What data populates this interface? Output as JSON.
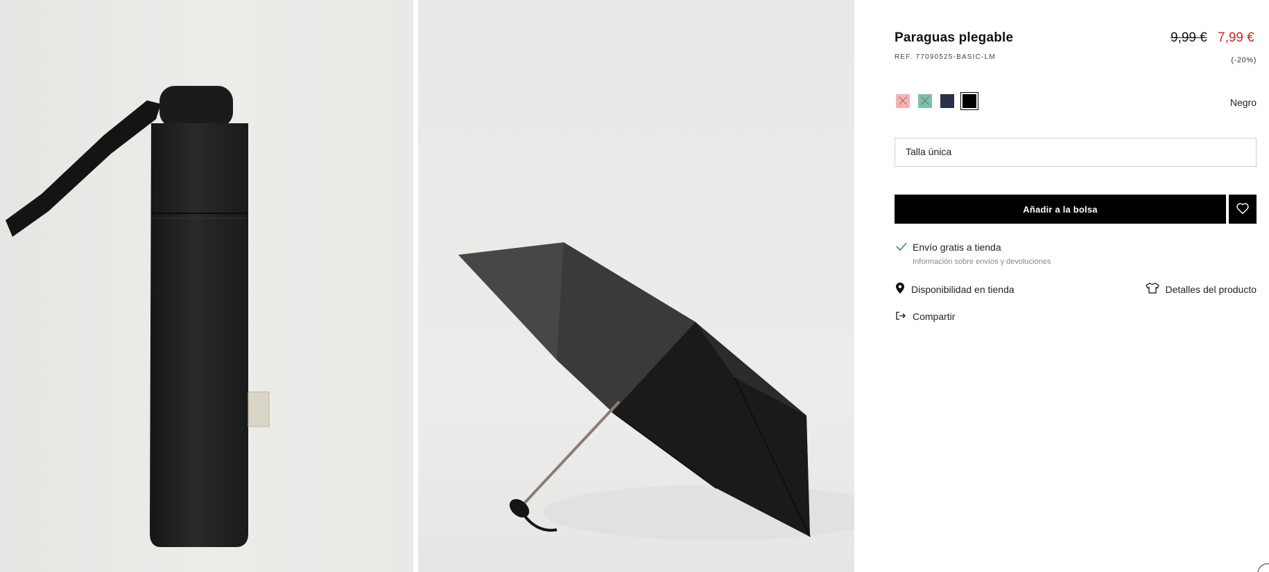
{
  "product": {
    "title": "Paraguas plegable",
    "ref": "REF. 77090525-BASIC-LM",
    "price_old": "9,99 €",
    "price_new": "7,99 €",
    "discount": "(-20%)"
  },
  "colors": {
    "selected_name": "Negro",
    "options": [
      {
        "name": "pink",
        "hex": "#f2b4b0",
        "available": false
      },
      {
        "name": "green",
        "hex": "#7fbfae",
        "available": false
      },
      {
        "name": "navy",
        "hex": "#2a3148",
        "available": true
      },
      {
        "name": "black",
        "hex": "#000000",
        "available": true
      }
    ]
  },
  "size": {
    "label": "Talla única"
  },
  "actions": {
    "add_to_bag": "Añadir a la bolsa",
    "wishlist_icon": "heart-icon"
  },
  "shipping": {
    "title": "Envío gratis a tienda",
    "info_link": "Información sobre envíos y devoluciones"
  },
  "links": {
    "availability": "Disponibilidad en tienda",
    "details": "Detalles del producto",
    "share": "Compartir"
  },
  "accent": {
    "price_red": "#c42a2a",
    "check_green": "#2e8b57"
  }
}
